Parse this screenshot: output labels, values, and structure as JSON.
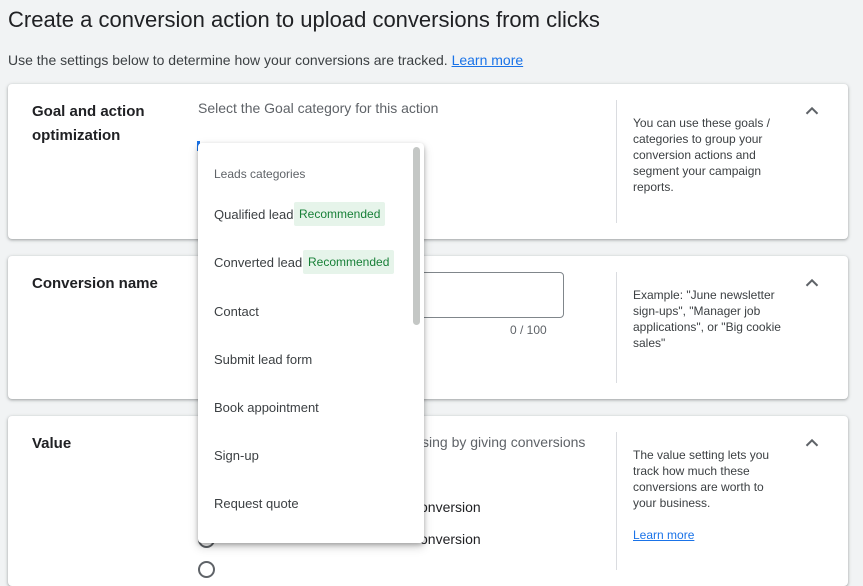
{
  "page": {
    "title": "Create a conversion action to upload conversions from clicks",
    "subtitle": "Use the settings below to determine how your conversions are tracked.",
    "learn_more": "Learn more"
  },
  "goal_card": {
    "title": "Goal and action optimization",
    "prompt": "Select the Goal category for this action",
    "help": "You can use these goals / categories to group your conversion actions and segment your campaign reports."
  },
  "name_card": {
    "title": "Conversion name",
    "counter": "0 / 100",
    "help": "Example: \"June newsletter sign-ups\", \"Manager job applications\", or \"Big cookie sales\""
  },
  "value_card": {
    "title": "Value",
    "prompt_partial": "sing by giving conversions",
    "option1_partial": "onversion",
    "option2_partial": "onversion",
    "help": "The value setting lets you track how much these conversions are worth to your business.",
    "learn_more": "Learn more"
  },
  "dropdown": {
    "group_label": "Leads categories",
    "items": [
      {
        "label": "Qualified lead",
        "badge": "Recommended"
      },
      {
        "label": "Converted lead",
        "badge": "Recommended"
      },
      {
        "label": "Contact"
      },
      {
        "label": "Submit lead form"
      },
      {
        "label": "Book appointment"
      },
      {
        "label": "Sign-up"
      },
      {
        "label": "Request quote"
      }
    ]
  },
  "icons": {
    "collapse": "chevron-up-icon",
    "radio": "radio-button-icon"
  },
  "colors": {
    "link": "#1a73e8",
    "badge_text": "#188038",
    "badge_bg": "#e6f4ea",
    "page_bg": "#f1f3f4"
  }
}
